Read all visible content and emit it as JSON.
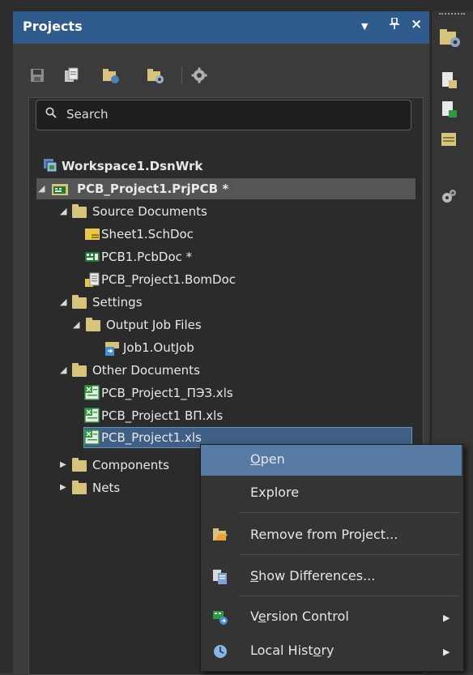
{
  "panel": {
    "title": "Projects",
    "controls": {
      "menu": "▼",
      "pin": "⊥",
      "close": "×"
    }
  },
  "search": {
    "placeholder": "Search"
  },
  "tree": {
    "workspace": "Workspace1.DsnWrk",
    "project": "PCB_Project1.PrjPCB *",
    "source_documents": {
      "label": "Source Documents",
      "items": [
        "Sheet1.SchDoc",
        "PCB1.PcbDoc *",
        "PCB_Project1.BomDoc"
      ]
    },
    "settings": {
      "label": "Settings",
      "output_job_files": {
        "label": "Output Job Files",
        "items": [
          "Job1.OutJob"
        ]
      }
    },
    "other_documents": {
      "label": "Other Documents",
      "items": [
        "PCB_Project1_ПЭЗ.xls",
        "PCB_Project1 ВП.xls",
        "PCB_Project1.xls"
      ]
    },
    "components": "Components",
    "nets": "Nets"
  },
  "context_menu": {
    "items": [
      {
        "label": "Open",
        "underline": "O",
        "rest": "pen"
      },
      {
        "label": "Explore"
      },
      {
        "label": "Remove from Project..."
      },
      {
        "label": "Show Differences...",
        "underline": "S",
        "rest": "how Differences..."
      },
      {
        "label": "Version Control",
        "pre": "V",
        "underline": "e",
        "rest": "rsion Control"
      },
      {
        "label": "Local History",
        "pre": "Local Hist",
        "underline": "o",
        "rest": "ry"
      }
    ]
  },
  "colors": {
    "titlebar": "#2f5b8c",
    "selection": "#3f5f86",
    "menu_highlight": "#587ba5",
    "folder": "#d6c47d",
    "excel_green": "#2f9a3c"
  }
}
